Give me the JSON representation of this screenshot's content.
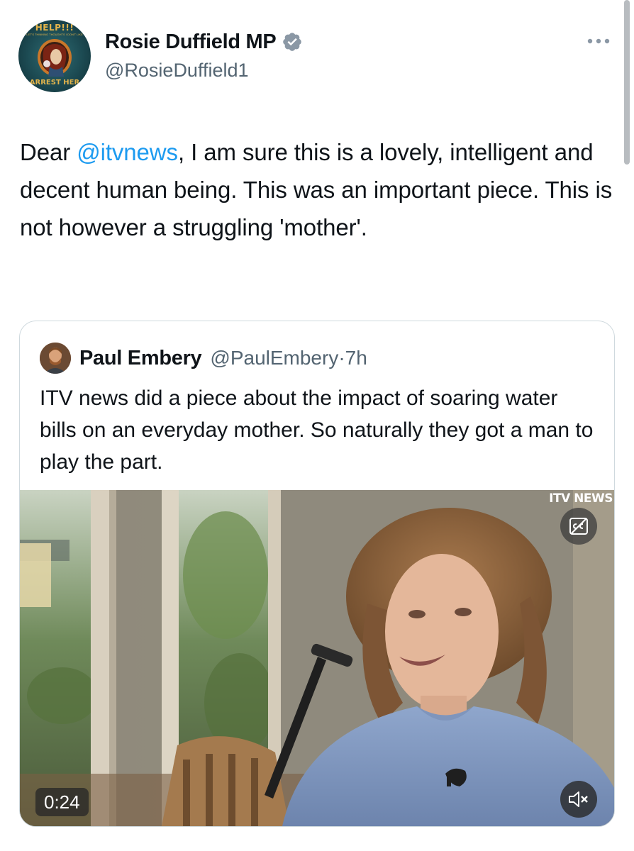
{
  "author": {
    "display_name": "Rosie Duffield MP",
    "handle": "@RosieDuffield1",
    "verified": true,
    "avatar": {
      "top_text": "HELP!!!",
      "ring_text": "LET'S THINKING THOUGHTS I DON'T LIKE",
      "bottom_text": "ARREST HER"
    }
  },
  "tweet": {
    "segments": {
      "before": "Dear ",
      "mention": "@itvnews",
      "after": ", I am sure this is a lovely, intelligent and decent human being. This was an important piece. This is not however a struggling 'mother'."
    }
  },
  "quoted_tweet": {
    "display_name": "Paul Embery",
    "handle": "@PaulEmbery",
    "separator": "·",
    "time": "7h",
    "text": "ITV news did a piece about the impact of soaring water bills on an everyday mother. So naturally they got a man to play the part.",
    "media": {
      "type": "video",
      "watermark": "ITV NEWS",
      "duration": "0:24",
      "muted": true,
      "captions_icon": "cc-icon",
      "mute_icon": "speaker-muted-icon"
    }
  },
  "colors": {
    "text_primary": "#0f1419",
    "text_secondary": "#536471",
    "link": "#1d9bf0",
    "verified_badge": "#8b98a5",
    "card_border": "#cfd9de"
  },
  "icons": {
    "more": "more-horizontal-icon",
    "verified": "verified-badge-icon"
  }
}
